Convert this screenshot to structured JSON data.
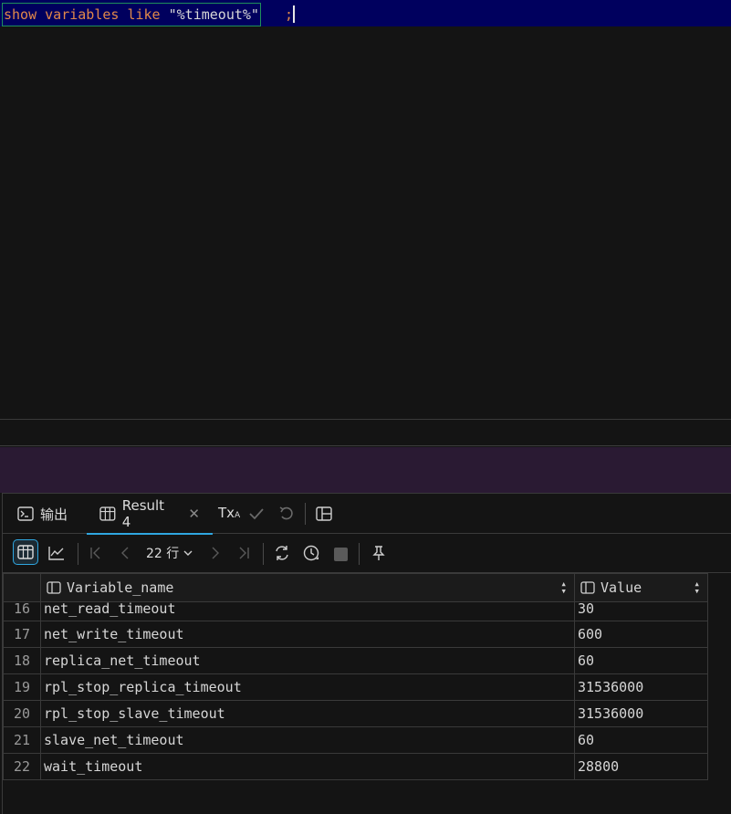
{
  "editor": {
    "sql_keyword_show": "show",
    "sql_keyword_variables": "variables",
    "sql_keyword_like": "like",
    "sql_pattern": "\"%timeout%\"",
    "sql_terminator": ";"
  },
  "result_panel": {
    "tabs": [
      {
        "label": "输出",
        "icon": "terminal-icon"
      },
      {
        "label": "Result 4",
        "icon": "table-icon",
        "active": true
      }
    ],
    "tx_label": "Tx",
    "tx_sub": "A",
    "row_count": "22 行",
    "columns": [
      {
        "label": "Variable_name",
        "icon": "column-icon"
      },
      {
        "label": "Value",
        "icon": "column-icon"
      }
    ],
    "rows": [
      {
        "num": "16",
        "name": "net_read_timeout",
        "value": "30"
      },
      {
        "num": "17",
        "name": "net_write_timeout",
        "value": "600"
      },
      {
        "num": "18",
        "name": "replica_net_timeout",
        "value": "60"
      },
      {
        "num": "19",
        "name": "rpl_stop_replica_timeout",
        "value": "31536000"
      },
      {
        "num": "20",
        "name": "rpl_stop_slave_timeout",
        "value": "31536000"
      },
      {
        "num": "21",
        "name": "slave_net_timeout",
        "value": "60"
      },
      {
        "num": "22",
        "name": "wait_timeout",
        "value": "28800"
      }
    ]
  },
  "colors": {
    "editor_line_bg": "#00005e",
    "keyword": "#e0884a",
    "active_tab_accent": "#2fa6e0",
    "purple_band": "#2a1a33"
  }
}
